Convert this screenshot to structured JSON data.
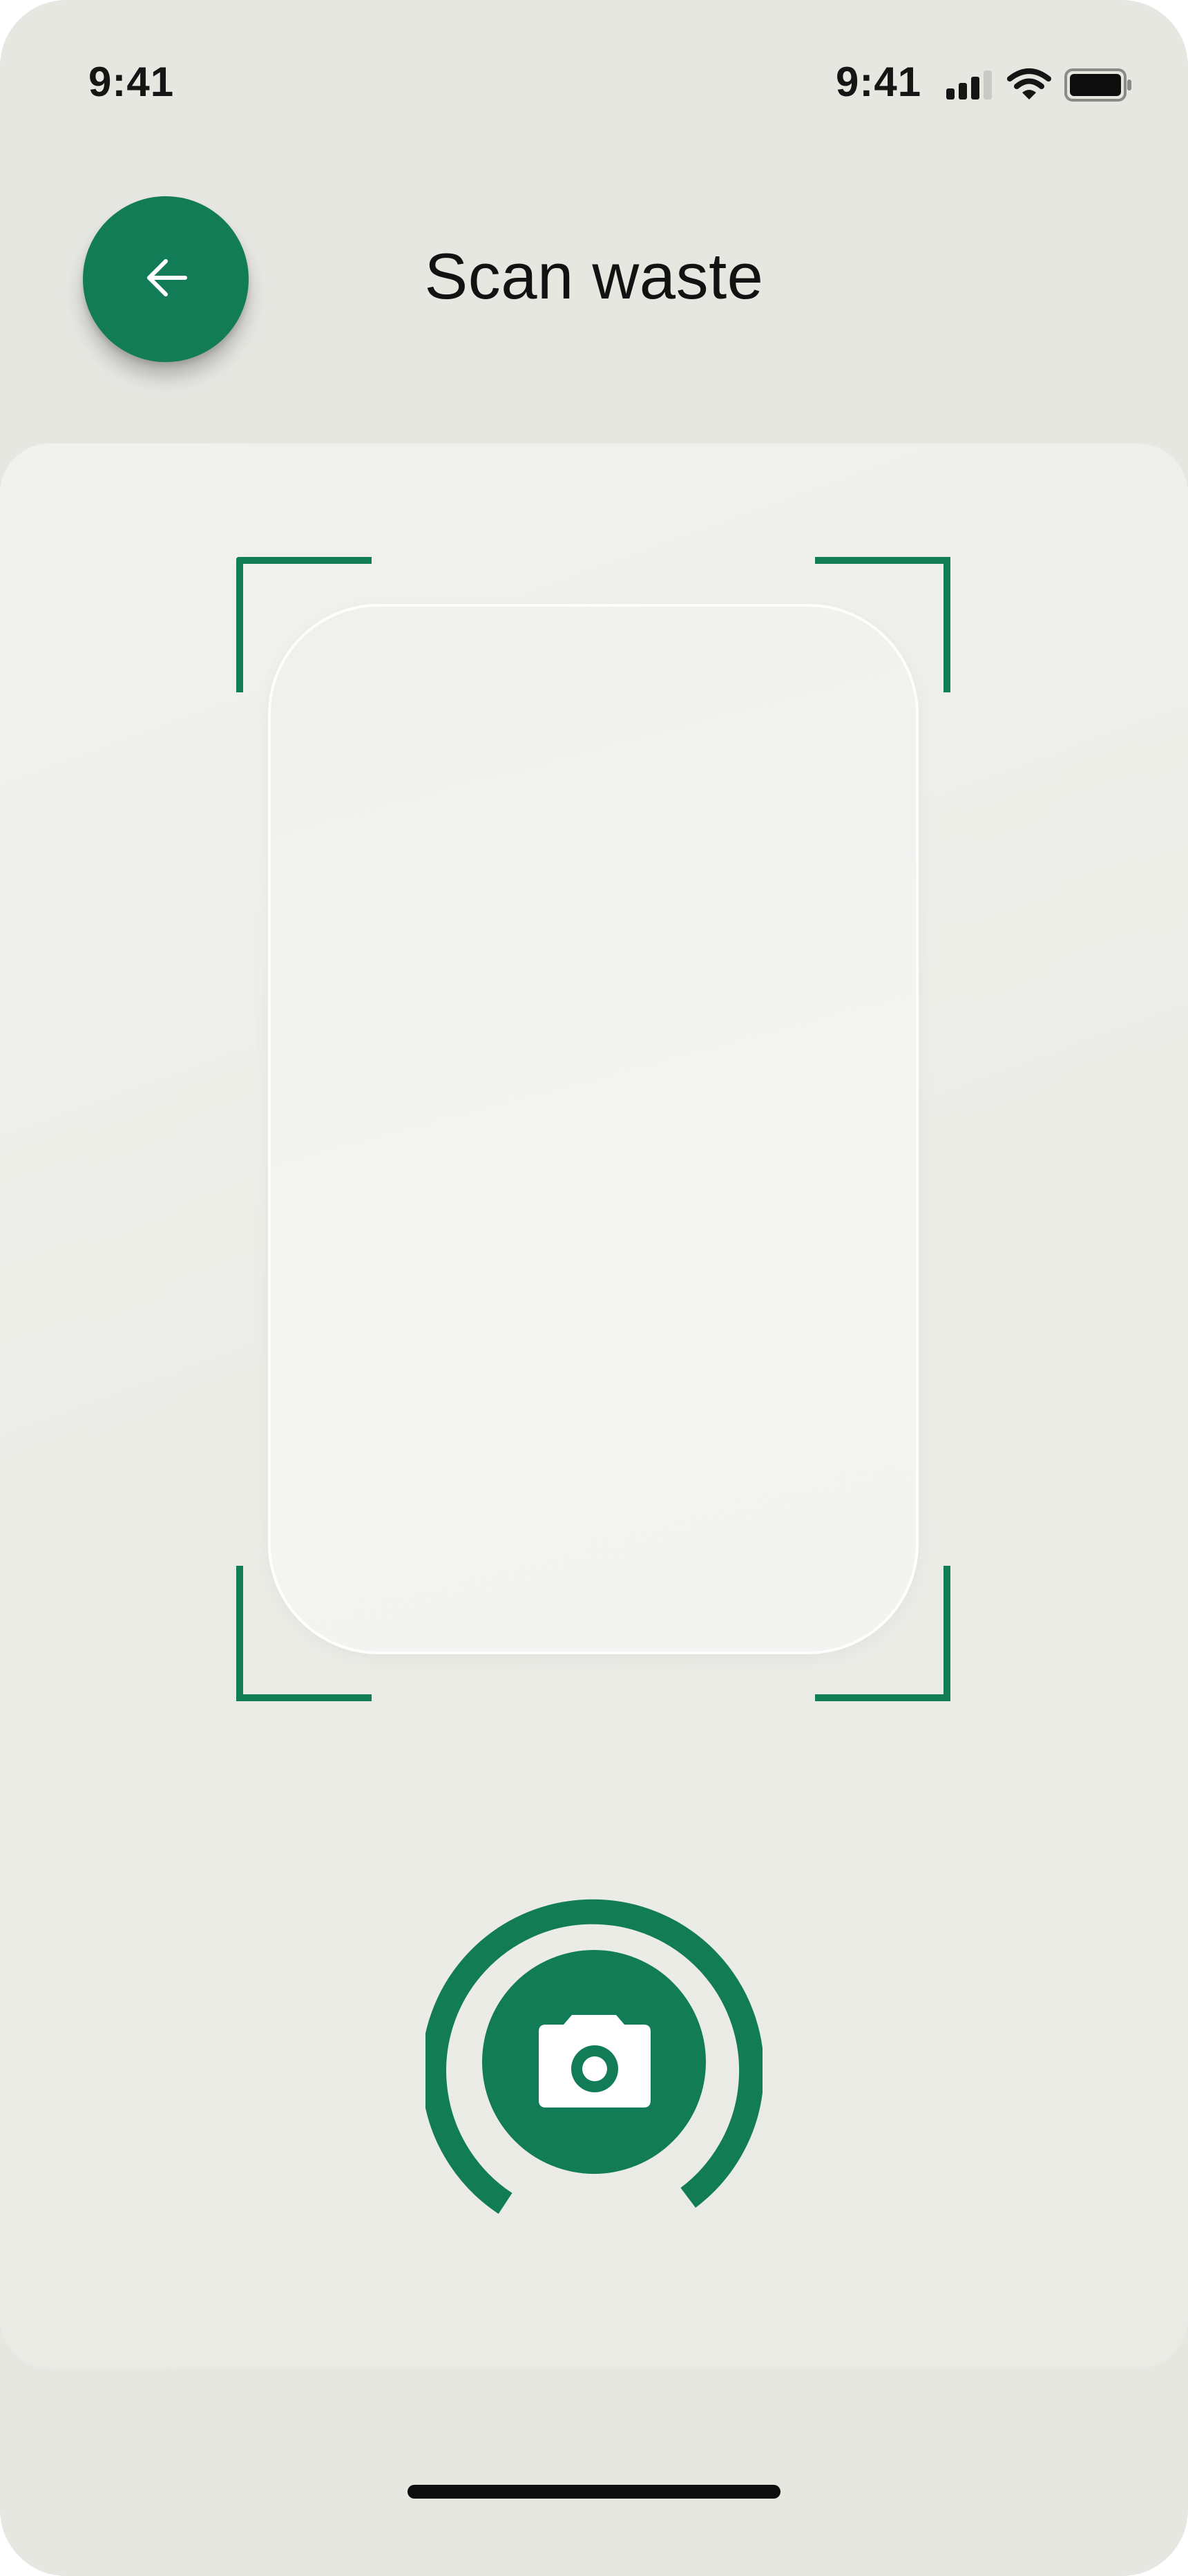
{
  "status_bar": {
    "time_left": "9:41",
    "time_right": "9:41",
    "signal_icon": "cellular-signal-icon",
    "wifi_icon": "wifi-icon",
    "battery_icon": "battery-icon"
  },
  "header": {
    "back_icon": "arrow-left-icon",
    "title": "Scan waste"
  },
  "scanner": {
    "shutter_icon": "camera-icon"
  },
  "colors": {
    "accent": "#127c56",
    "background": "#e7e7e2",
    "panel": "#ecece7",
    "text": "#121212"
  }
}
